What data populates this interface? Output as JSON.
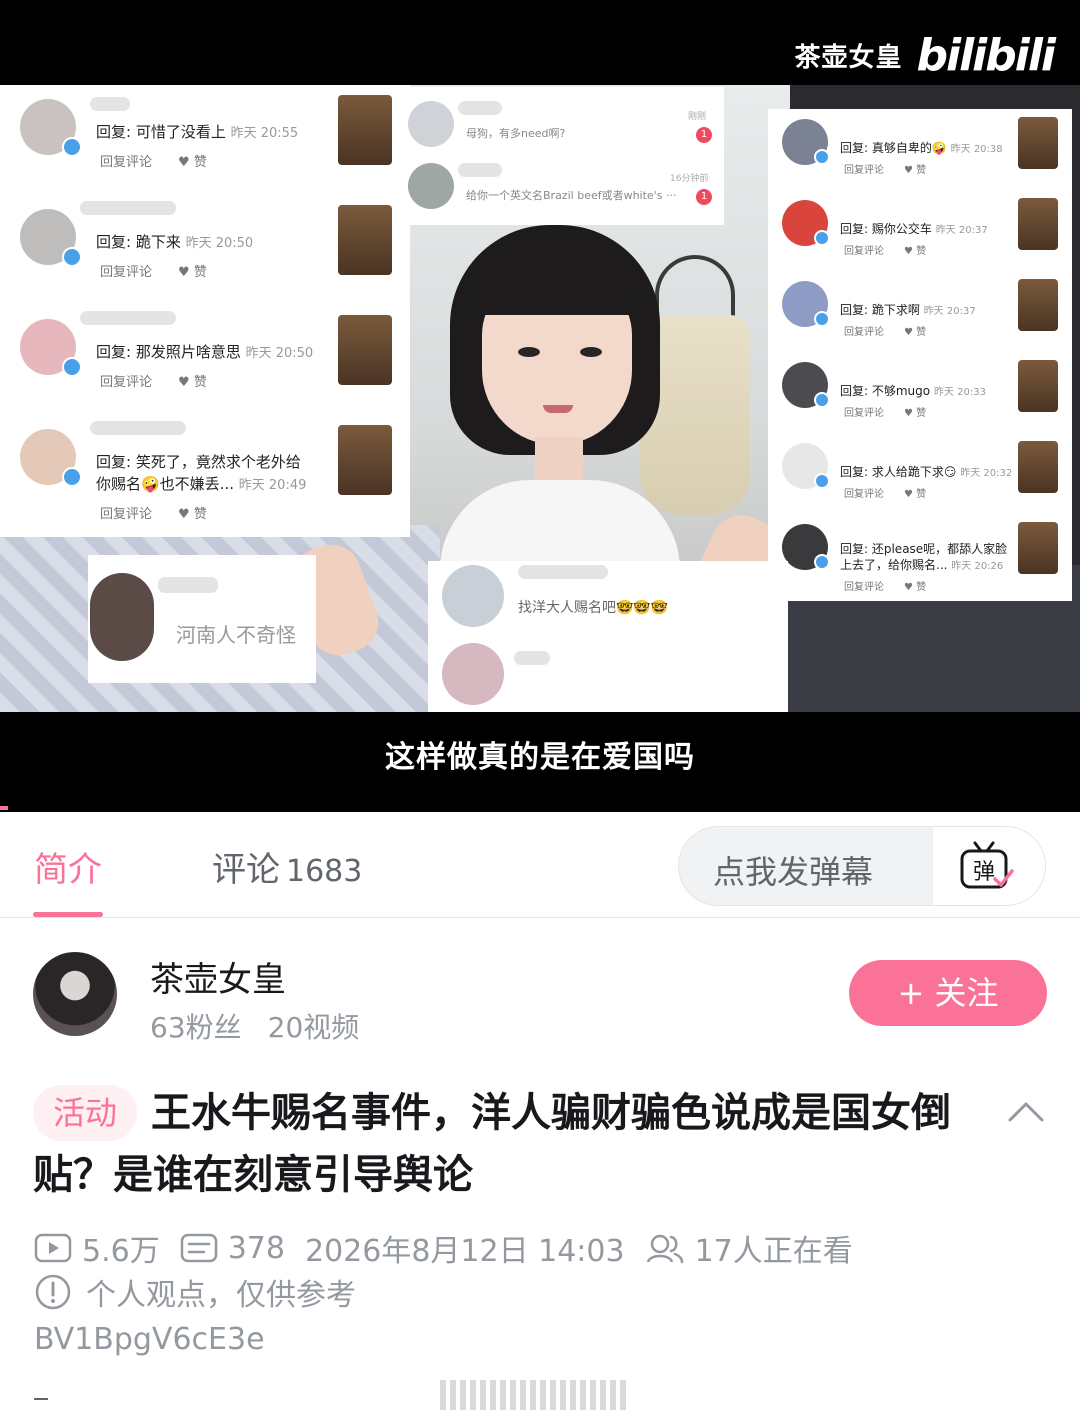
{
  "video": {
    "brand_name": "茶壶女皇",
    "brand_logo": "bilibili",
    "subtitle": "这样做真的是在爱国吗",
    "comments_left": [
      {
        "reply": "回复: 可惜了没看上",
        "time": "昨天 20:55",
        "reply_action": "回复评论",
        "like": "赞"
      },
      {
        "reply": "回复: 跪下来",
        "time": "昨天 20:50",
        "reply_action": "回复评论",
        "like": "赞"
      },
      {
        "reply": "回复: 那发照片啥意思",
        "time": "昨天 20:50",
        "reply_action": "回复评论",
        "like": "赞"
      },
      {
        "reply": "回复: 笑死了，竟然求个老外给",
        "reply2": "你赐名🤪也不嫌丢...",
        "time": "昨天 20:49",
        "reply_action": "回复评论",
        "like": "赞"
      }
    ],
    "messages_top": [
      {
        "text": "母狗，有多need啊?",
        "time": "刚刚",
        "badge": "1"
      },
      {
        "text": "给你一个英文名Brazil beef或者white's ···",
        "time": "16分钟前",
        "badge": "1"
      }
    ],
    "comments_right": [
      {
        "reply": "回复: 真够自卑的🤪",
        "time": "昨天 20:38",
        "reply_action": "回复评论",
        "like": "赞"
      },
      {
        "reply": "回复: 赐你公交车",
        "time": "昨天 20:37",
        "reply_action": "回复评论",
        "like": "赞"
      },
      {
        "reply": "回复: 跪下求啊",
        "time": "昨天 20:37",
        "reply_action": "回复评论",
        "like": "赞"
      },
      {
        "reply": "回复: 不够mugo",
        "time": "昨天 20:33",
        "reply_action": "回复评论",
        "like": "赞"
      },
      {
        "reply": "回复: 求人给跪下求😏",
        "time": "昨天 20:32",
        "reply_action": "回复评论",
        "like": "赞"
      },
      {
        "reply": "回复: 还please呢，都舔人家脸",
        "reply2": "上去了，给你赐名...",
        "time": "昨天 20:26",
        "reply_action": "回复评论",
        "like": "赞"
      }
    ],
    "bubble_henan": "河南人不奇怪",
    "bubble_center": "找洋大人赐名吧🤓🤓🤓"
  },
  "tabs": {
    "intro": "简介",
    "comment": "评论",
    "comment_count": "1683",
    "danmaku_placeholder": "点我发弹幕",
    "danmaku_icon_label": "弹"
  },
  "uploader": {
    "name": "茶壶女皇",
    "fans": "63粉丝",
    "videos": "20视频",
    "follow_label": "+ 关注"
  },
  "title": {
    "tag": "活动",
    "text": "王水牛赐名事件，洋人骗财骗色说成是国女倒贴？是谁在刻意引导舆论"
  },
  "meta": {
    "views": "5.6万",
    "danmaku": "378",
    "datetime": "2026年8月12日 14:03",
    "watching": "17人正在看",
    "notice": "个人观点，仅供参考",
    "bvid": "BV1BpgV6cE3e"
  },
  "colors": {
    "accent": "#fb7299",
    "text_secondary": "#9499a0",
    "verify_blue": "#4aa0e8"
  }
}
